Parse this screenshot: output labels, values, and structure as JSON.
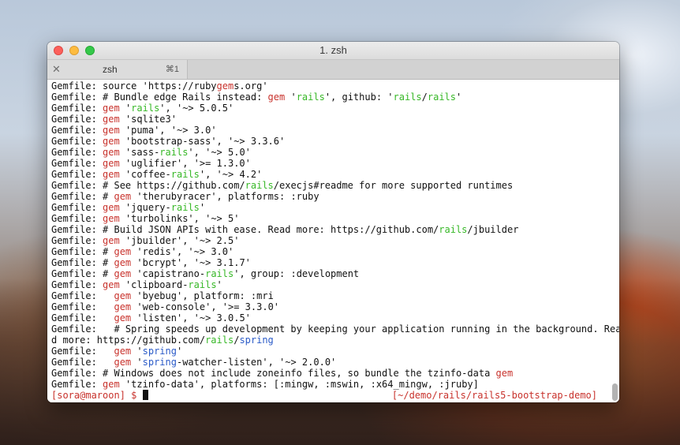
{
  "window": {
    "title": "1. zsh",
    "tab": {
      "label": "zsh",
      "shortcut": "⌘1",
      "close_glyph": "✕"
    }
  },
  "colors": {
    "keyword": "#c8322c",
    "highlight": "#37b827",
    "link": "#2b5bc8",
    "prompt": "#c8322c"
  },
  "terminal": {
    "lines": [
      [
        {
          "t": "Gemfile: source 'https://ruby"
        },
        {
          "t": "gem",
          "c": "kw"
        },
        {
          "t": "s.org'"
        }
      ],
      [
        {
          "t": "Gemfile: # Bundle edge Rails instead: "
        },
        {
          "t": "gem",
          "c": "kw"
        },
        {
          "t": " '"
        },
        {
          "t": "rails",
          "c": "hl"
        },
        {
          "t": "', github: '"
        },
        {
          "t": "rails",
          "c": "hl"
        },
        {
          "t": "/"
        },
        {
          "t": "rails",
          "c": "hl"
        },
        {
          "t": "'"
        }
      ],
      [
        {
          "t": "Gemfile: "
        },
        {
          "t": "gem",
          "c": "kw"
        },
        {
          "t": " '"
        },
        {
          "t": "rails",
          "c": "hl"
        },
        {
          "t": "', '~> 5.0.5'"
        }
      ],
      [
        {
          "t": "Gemfile: "
        },
        {
          "t": "gem",
          "c": "kw"
        },
        {
          "t": " 'sqlite3'"
        }
      ],
      [
        {
          "t": "Gemfile: "
        },
        {
          "t": "gem",
          "c": "kw"
        },
        {
          "t": " 'puma', '~> 3.0'"
        }
      ],
      [
        {
          "t": "Gemfile: "
        },
        {
          "t": "gem",
          "c": "kw"
        },
        {
          "t": " 'bootstrap-sass', '~> 3.3.6'"
        }
      ],
      [
        {
          "t": "Gemfile: "
        },
        {
          "t": "gem",
          "c": "kw"
        },
        {
          "t": " 'sass-"
        },
        {
          "t": "rails",
          "c": "hl"
        },
        {
          "t": "', '~> 5.0'"
        }
      ],
      [
        {
          "t": "Gemfile: "
        },
        {
          "t": "gem",
          "c": "kw"
        },
        {
          "t": " 'uglifier', '>= 1.3.0'"
        }
      ],
      [
        {
          "t": "Gemfile: "
        },
        {
          "t": "gem",
          "c": "kw"
        },
        {
          "t": " 'coffee-"
        },
        {
          "t": "rails",
          "c": "hl"
        },
        {
          "t": "', '~> 4.2'"
        }
      ],
      [
        {
          "t": "Gemfile: # See https://github.com/"
        },
        {
          "t": "rails",
          "c": "hl"
        },
        {
          "t": "/execjs#readme for more supported runtimes"
        }
      ],
      [
        {
          "t": "Gemfile: # "
        },
        {
          "t": "gem",
          "c": "kw"
        },
        {
          "t": " 'therubyracer', platforms: :ruby"
        }
      ],
      [
        {
          "t": "Gemfile: "
        },
        {
          "t": "gem",
          "c": "kw"
        },
        {
          "t": " 'jquery-"
        },
        {
          "t": "rails",
          "c": "hl"
        },
        {
          "t": "'"
        }
      ],
      [
        {
          "t": "Gemfile: "
        },
        {
          "t": "gem",
          "c": "kw"
        },
        {
          "t": " 'turbolinks', '~> 5'"
        }
      ],
      [
        {
          "t": "Gemfile: # Build JSON APIs with ease. Read more: https://github.com/"
        },
        {
          "t": "rails",
          "c": "hl"
        },
        {
          "t": "/jbuilder"
        }
      ],
      [
        {
          "t": "Gemfile: "
        },
        {
          "t": "gem",
          "c": "kw"
        },
        {
          "t": " 'jbuilder', '~> 2.5'"
        }
      ],
      [
        {
          "t": "Gemfile: # "
        },
        {
          "t": "gem",
          "c": "kw"
        },
        {
          "t": " 'redis', '~> 3.0'"
        }
      ],
      [
        {
          "t": "Gemfile: # "
        },
        {
          "t": "gem",
          "c": "kw"
        },
        {
          "t": " 'bcrypt', '~> 3.1.7'"
        }
      ],
      [
        {
          "t": "Gemfile: # "
        },
        {
          "t": "gem",
          "c": "kw"
        },
        {
          "t": " 'capistrano-"
        },
        {
          "t": "rails",
          "c": "hl"
        },
        {
          "t": "', group: :development"
        }
      ],
      [
        {
          "t": "Gemfile: "
        },
        {
          "t": "gem",
          "c": "kw"
        },
        {
          "t": " 'clipboard-"
        },
        {
          "t": "rails",
          "c": "hl"
        },
        {
          "t": "'"
        }
      ],
      [
        {
          "t": "Gemfile:   "
        },
        {
          "t": "gem",
          "c": "kw"
        },
        {
          "t": " 'byebug', platform: :mri"
        }
      ],
      [
        {
          "t": "Gemfile:   "
        },
        {
          "t": "gem",
          "c": "kw"
        },
        {
          "t": " 'web-console', '>= 3.3.0'"
        }
      ],
      [
        {
          "t": "Gemfile:   "
        },
        {
          "t": "gem",
          "c": "kw"
        },
        {
          "t": " 'listen', '~> 3.0.5'"
        }
      ],
      [
        {
          "t": "Gemfile:   # Spring speeds up development by keeping your application running in the background. Rea"
        }
      ],
      [
        {
          "t": "d more: https://github.com/"
        },
        {
          "t": "rails",
          "c": "hl"
        },
        {
          "t": "/"
        },
        {
          "t": "spring",
          "c": "blue"
        }
      ],
      [
        {
          "t": "Gemfile:   "
        },
        {
          "t": "gem",
          "c": "kw"
        },
        {
          "t": " '"
        },
        {
          "t": "spring",
          "c": "blue"
        },
        {
          "t": "'"
        }
      ],
      [
        {
          "t": "Gemfile:   "
        },
        {
          "t": "gem",
          "c": "kw"
        },
        {
          "t": " '"
        },
        {
          "t": "spring",
          "c": "blue"
        },
        {
          "t": "-watcher-listen', '~> 2.0.0'"
        }
      ],
      [
        {
          "t": "Gemfile: # Windows does not include zoneinfo files, so bundle the tzinfo-data "
        },
        {
          "t": "gem",
          "c": "kw"
        }
      ],
      [
        {
          "t": "Gemfile: "
        },
        {
          "t": "gem",
          "c": "kw"
        },
        {
          "t": " 'tzinfo-data', platforms: [:mingw, :mswin, :x64_mingw, :jruby]"
        }
      ]
    ],
    "prompt": "[sora@maroon] $ ",
    "cwd": "[~/demo/rails/rails5-bootstrap-demo]"
  }
}
